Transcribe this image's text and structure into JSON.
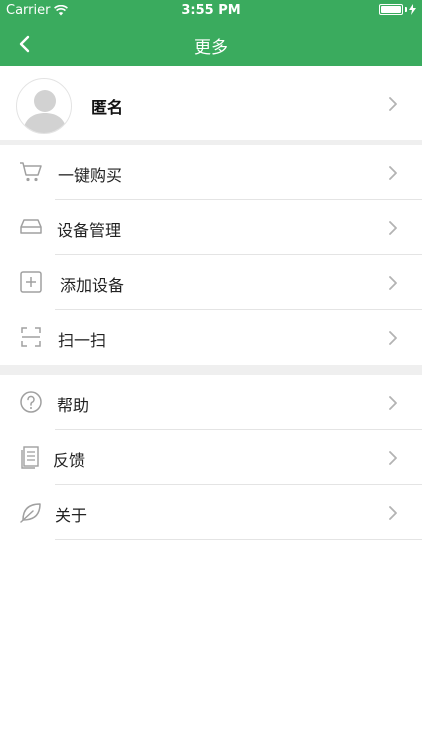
{
  "status_bar": {
    "carrier": "Carrier",
    "time": "3:55 PM"
  },
  "nav": {
    "title": "更多",
    "back_icon": "chevron-left-icon"
  },
  "profile": {
    "name": "匿名",
    "avatar_icon": "avatar-placeholder-icon"
  },
  "group1": [
    {
      "icon": "cart-icon",
      "label": "一键购买"
    },
    {
      "icon": "device-icon",
      "label": "设备管理"
    },
    {
      "icon": "add-box-icon",
      "label": "添加设备"
    },
    {
      "icon": "scan-icon",
      "label": "扫一扫"
    }
  ],
  "group2": [
    {
      "icon": "help-icon",
      "label": "帮助"
    },
    {
      "icon": "feedback-icon",
      "label": "反馈"
    },
    {
      "icon": "leaf-icon",
      "label": "关于"
    }
  ],
  "colors": {
    "brand": "#3aab5e",
    "separator": "#efefef",
    "icon": "#a0a0a0"
  }
}
